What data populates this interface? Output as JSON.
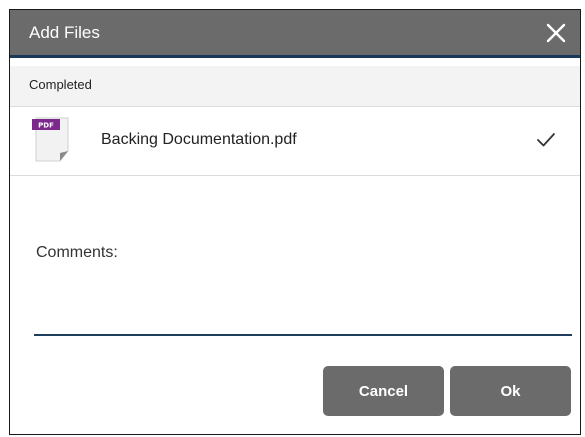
{
  "dialog": {
    "title": "Add Files",
    "close_icon": "close-icon"
  },
  "section": {
    "heading": "Completed"
  },
  "files": [
    {
      "name": "Backing Documentation.pdf",
      "icon": "pdf-file-icon",
      "icon_label": "PDF",
      "status_icon": "checkmark-icon"
    }
  ],
  "comments": {
    "label": "Comments:",
    "value": "",
    "placeholder": ""
  },
  "buttons": {
    "cancel": "Cancel",
    "ok": "Ok"
  },
  "colors": {
    "titlebar": "#6b6b6b",
    "titlebar_accent": "#173a5a",
    "button": "#6b6b6b",
    "pdf_badge": "#7b2a8c",
    "input_underline": "#1f3e5c"
  }
}
